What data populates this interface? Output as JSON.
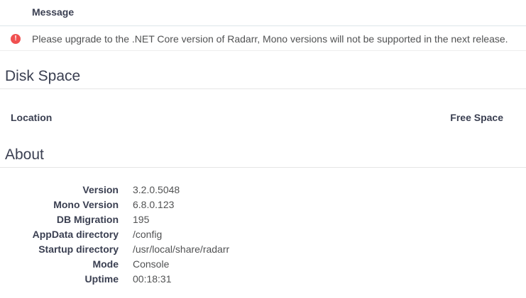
{
  "health": {
    "column_message": "Message",
    "rows": [
      {
        "icon": "error-circle-icon",
        "icon_glyph": "!",
        "message": "Please upgrade to the .NET Core version of Radarr, Mono versions will not be supported in the next release."
      }
    ]
  },
  "disk_space": {
    "title": "Disk Space",
    "columns": {
      "location": "Location",
      "free_space": "Free Space"
    }
  },
  "about": {
    "title": "About",
    "items": [
      {
        "label": "Version",
        "value": "3.2.0.5048"
      },
      {
        "label": "Mono Version",
        "value": "6.8.0.123"
      },
      {
        "label": "DB Migration",
        "value": "195"
      },
      {
        "label": "AppData directory",
        "value": "/config"
      },
      {
        "label": "Startup directory",
        "value": "/usr/local/share/radarr"
      },
      {
        "label": "Mode",
        "value": "Console"
      },
      {
        "label": "Uptime",
        "value": "00:18:31"
      }
    ]
  },
  "colors": {
    "error": "#f05050",
    "heading": "#3a3f51",
    "text": "#515253",
    "divider": "#e5e5e5"
  }
}
